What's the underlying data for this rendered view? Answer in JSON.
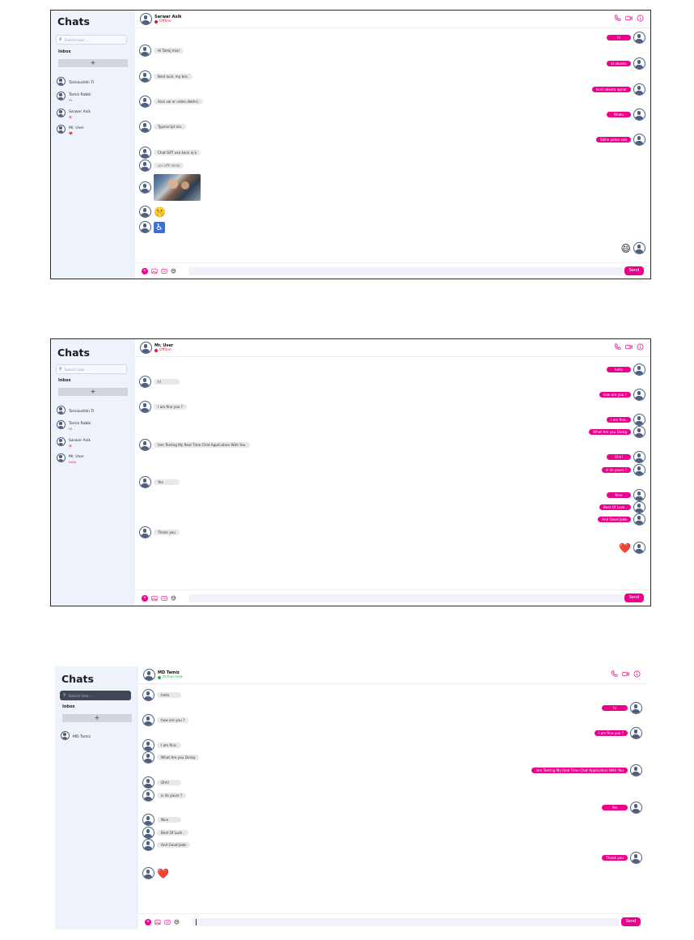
{
  "colors": {
    "accent": "#ec008c",
    "offline": "#e1183c",
    "online": "#22b14c",
    "sidebar_bg": "#eef3fb"
  },
  "panels": [
    {
      "sidebar": {
        "title": "Chats",
        "search_placeholder": "Search User ...",
        "inbox_label": "Inbox",
        "add_label": "+",
        "contacts": [
          {
            "name": "Tamizuddin Tr",
            "preview": ""
          },
          {
            "name": "Tamiz Rabbi",
            "preview": "Hi"
          },
          {
            "name": "Sarwar Asik",
            "preview": "😄"
          },
          {
            "name": "Mr. User",
            "preview": "❤️"
          }
        ]
      },
      "header": {
        "name": "Sarwar Asik",
        "status": "Offline"
      },
      "messages": [
        {
          "side": "out",
          "text": "hi"
        },
        {
          "side": "in",
          "text": "Hi Tamij mia!"
        },
        {
          "side": "out",
          "text": "ki obosta"
        },
        {
          "side": "in",
          "text": "Best luck, my bro."
        },
        {
          "side": "out",
          "text": "to ki obosta apnar"
        },
        {
          "side": "in",
          "text": "Anis vai er video dekhsi."
        },
        {
          "side": "out",
          "text": "Bhalo"
        },
        {
          "side": "in",
          "text": "Typescript nio."
        },
        {
          "side": "out",
          "text": "Sikhe pelen sob"
        },
        {
          "side": "in",
          "text": "Chat GPT use korsi oj k"
        },
        {
          "side": "in",
          "text": "এস দেখি আবার"
        },
        {
          "side": "in",
          "kind": "image"
        },
        {
          "side": "in",
          "kind": "emoji",
          "text": "🤫"
        },
        {
          "side": "in",
          "kind": "emoji",
          "text": "♿"
        },
        {
          "side": "out",
          "kind": "emoji",
          "text": "😄"
        }
      ],
      "composer": {
        "send_label": "Send",
        "emoji": "😅"
      }
    },
    {
      "sidebar": {
        "title": "Chats",
        "search_placeholder": "Search User ...",
        "inbox_label": "Inbox",
        "add_label": "+",
        "contacts": [
          {
            "name": "Tamizuddin Tr",
            "preview": ""
          },
          {
            "name": "Tamiz Rabbi",
            "preview": "Hi"
          },
          {
            "name": "Sarwar Asik",
            "preview": "😄"
          },
          {
            "name": "Mr. User",
            "preview": "hello"
          }
        ]
      },
      "header": {
        "name": "Mr. User",
        "status": "Offline"
      },
      "messages": [
        {
          "side": "out",
          "text": "hello"
        },
        {
          "side": "in",
          "text": "hi"
        },
        {
          "side": "out",
          "text": "how are you ?"
        },
        {
          "side": "in",
          "text": "I am fine you ?"
        },
        {
          "side": "out",
          "text": "I am fine."
        },
        {
          "side": "out",
          "text": "What Are you Doing"
        },
        {
          "side": "in",
          "text": "Iam Testing My Real Time Chat Application With You"
        },
        {
          "side": "out",
          "text": "Ohh!"
        },
        {
          "side": "out",
          "text": "is its yours ?"
        },
        {
          "side": "in",
          "text": "Yes"
        },
        {
          "side": "out",
          "text": "Nice"
        },
        {
          "side": "out",
          "text": "Best Of Luck ."
        },
        {
          "side": "out",
          "text": "And Good Joob"
        },
        {
          "side": "in",
          "text": "Thank you"
        },
        {
          "side": "out",
          "kind": "emoji",
          "text": "❤️"
        }
      ],
      "composer": {
        "send_label": "Send",
        "emoji": "😅"
      }
    },
    {
      "sidebar": {
        "title": "Chats",
        "search_placeholder": "Search User ...",
        "inbox_label": "Inbox",
        "add_label": "+",
        "contacts": [
          {
            "name": "MD Tamiz",
            "preview": ""
          }
        ]
      },
      "header": {
        "name": "MD Tamiz",
        "status": "Active now"
      },
      "messages": [
        {
          "side": "in",
          "text": "hello"
        },
        {
          "side": "out",
          "text": "hi"
        },
        {
          "side": "in",
          "text": "how are you ?"
        },
        {
          "side": "out",
          "text": "I am fine you ?"
        },
        {
          "side": "in",
          "text": "I am fine."
        },
        {
          "side": "in",
          "text": "What Are you Doing"
        },
        {
          "side": "out",
          "text": "Iam Testing My Real Time Chat Application With You"
        },
        {
          "side": "in",
          "text": "Ohh!"
        },
        {
          "side": "in",
          "text": "is its yours ?"
        },
        {
          "side": "out",
          "text": "Yes"
        },
        {
          "side": "in",
          "text": "Nice"
        },
        {
          "side": "in",
          "text": "Best Of Luck ."
        },
        {
          "side": "in",
          "text": "And Good Joob"
        },
        {
          "side": "out",
          "text": "Thank you"
        },
        {
          "side": "in",
          "kind": "emoji",
          "text": "❤️"
        }
      ],
      "composer": {
        "send_label": "Send",
        "emoji": "😅"
      }
    }
  ]
}
